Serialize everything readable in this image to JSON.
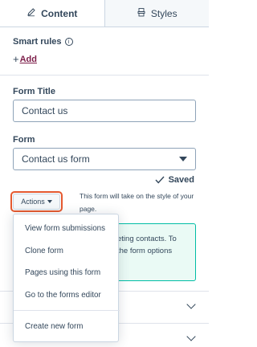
{
  "tabs": [
    {
      "label": "Content",
      "icon": "pencil-icon",
      "active": true
    },
    {
      "label": "Styles",
      "icon": "paint-bucket-icon",
      "active": false
    }
  ],
  "smart_rules": {
    "title": "Smart rules",
    "info_icon": "info-icon",
    "add_label": "Add"
  },
  "form_title": {
    "label": "Form Title",
    "value": "Contact us"
  },
  "form": {
    "label": "Form",
    "selected": "Contact us form",
    "saved_label": "Saved"
  },
  "actions": {
    "button_label": "Actions",
    "note": "This form will take on the style of your page."
  },
  "green_box": {
    "line1": "eting contacts. To",
    "line2": "the form options"
  },
  "menu": {
    "items": [
      "View form submissions",
      "Clone form",
      "Pages using this form",
      "Go to the forms editor",
      "Create new form"
    ]
  },
  "colors": {
    "accent": "#7c1d49",
    "highlight_ring": "#e5592f",
    "green_border": "#00bda5",
    "text": "#33475b"
  }
}
